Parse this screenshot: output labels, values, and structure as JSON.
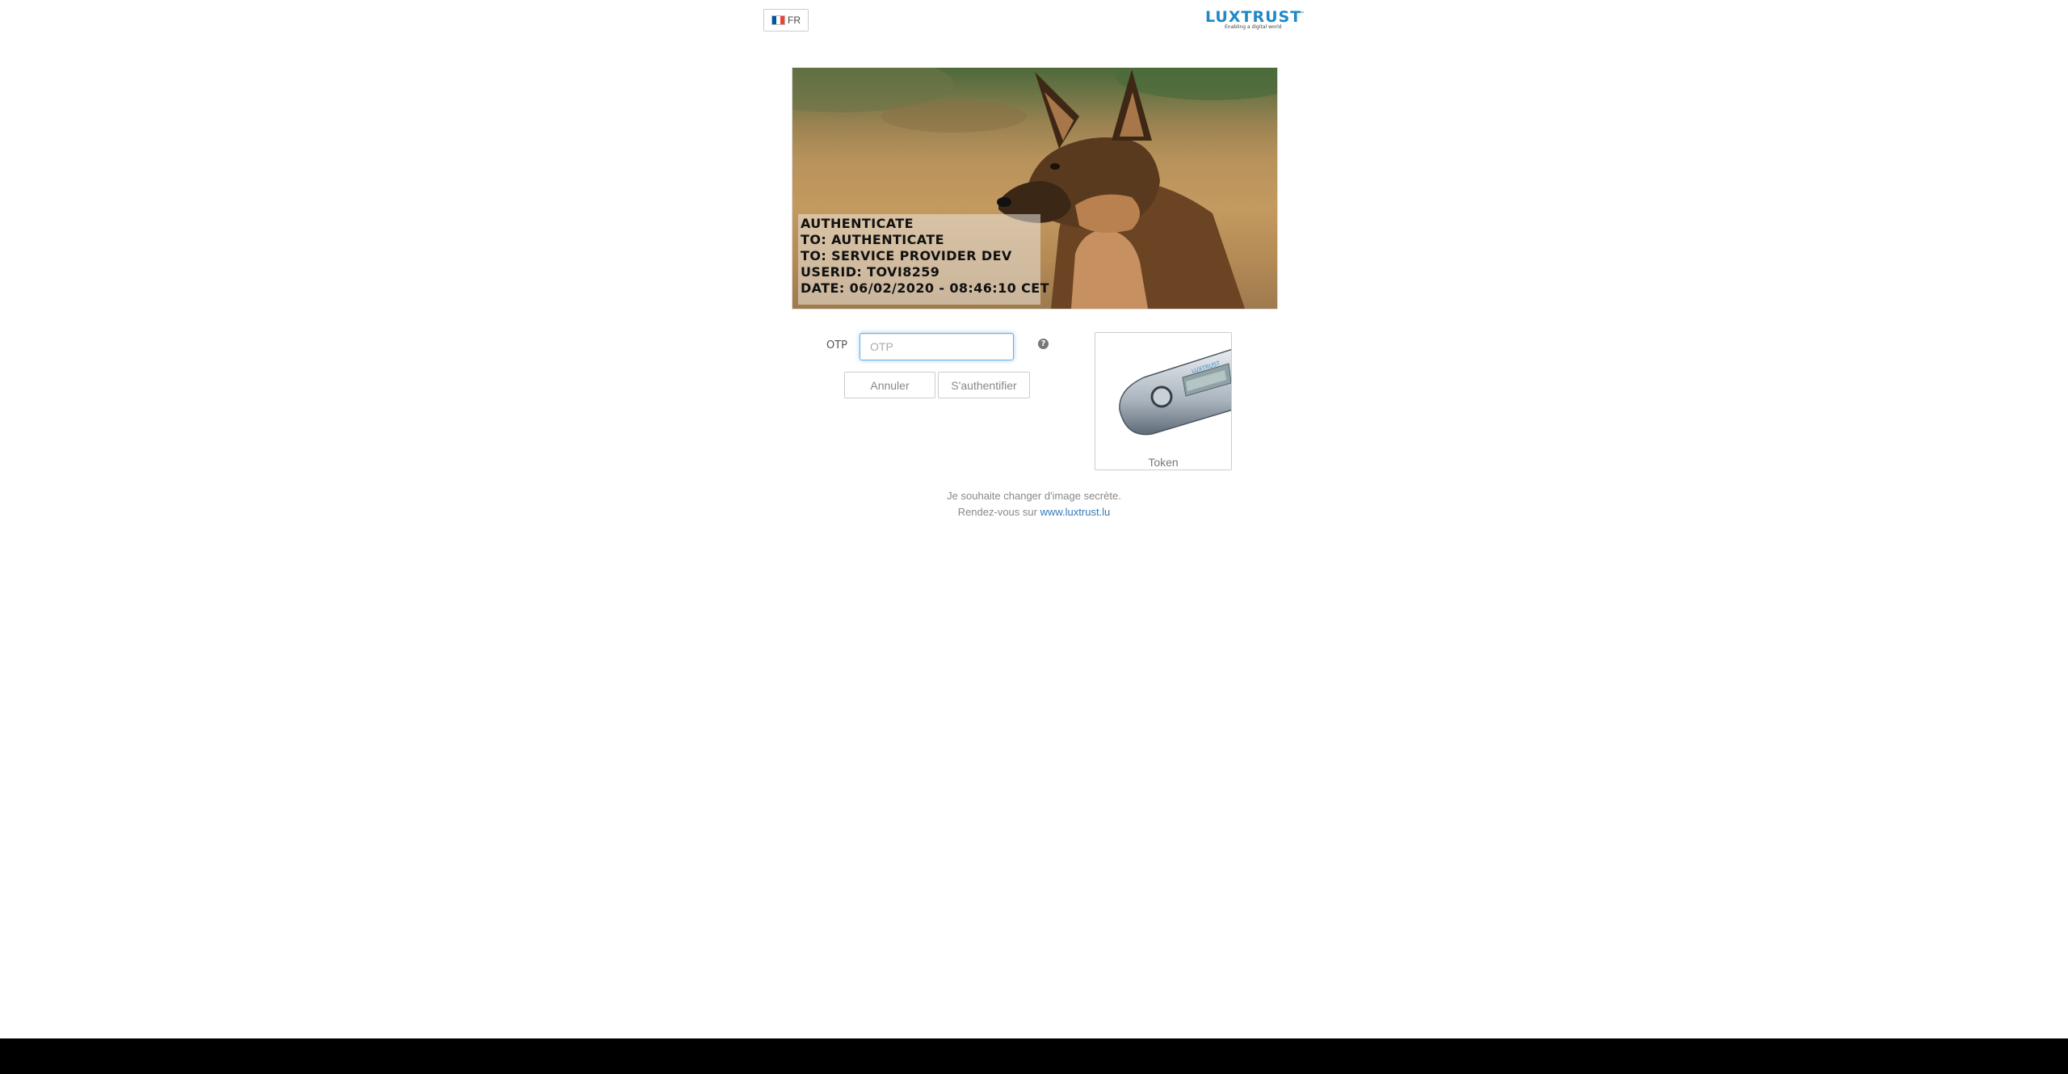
{
  "language": {
    "code": "FR",
    "flag_colors": [
      "#0055a4",
      "#ffffff",
      "#ef4135"
    ]
  },
  "logo": {
    "text": "LUXTRUST",
    "tagline": "Enabling a digital world",
    "trademark": "™",
    "color": "#1e88c8"
  },
  "secret_image": {
    "lines": [
      "AUTHENTICATE",
      "TO: AUTHENTICATE",
      "TO: SERVICE PROVIDER DEV",
      "USERID: TOVI8259",
      "DATE: 06/02/2020 - 08:46:10 CET"
    ]
  },
  "form": {
    "otp_label": "OTP",
    "otp_placeholder": "OTP",
    "otp_value": "",
    "help_icon": "question-circle-icon",
    "cancel_label": "Annuler",
    "submit_label": "S'authentifier"
  },
  "token": {
    "label": "Token"
  },
  "footer": {
    "change_image_text": "Je souhaite changer d'image secrète.",
    "visit_prefix": "Rendez-vous sur",
    "link_text": "www.luxtrust.lu"
  },
  "colors": {
    "link": "#337ab7",
    "focus": "#66afe9",
    "bottom_bar": "#000000"
  }
}
